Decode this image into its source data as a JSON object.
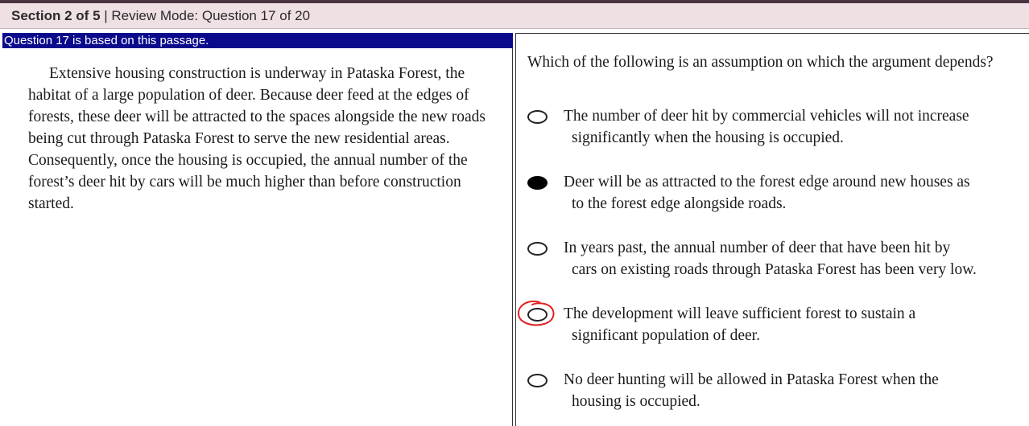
{
  "header": {
    "section": "Section 2 of 5",
    "separator": " | ",
    "mode": "Review Mode: Question 17 of 20"
  },
  "passage": {
    "bar_label": "Question 17 is based on this passage.",
    "text": "Extensive housing construction is underway in Pataska Forest, the habitat of a large population of deer. Because deer feed at the edges of forests, these deer will be attracted to the spaces alongside the new roads being cut through Pataska Forest to serve the new residential areas. Consequently, once the housing is occupied, the annual number of the forest’s deer hit by cars will be much higher than before construction started."
  },
  "question": {
    "stem": "Which of the following is an assumption on which the argument depends?",
    "choices": [
      {
        "line1": "The number of deer hit by commercial vehicles will not increase",
        "line2": "significantly when the housing is occupied.",
        "selected": false
      },
      {
        "line1": "Deer will be as attracted to the forest edge around new houses as",
        "line2": "to the forest edge alongside roads.",
        "selected": true
      },
      {
        "line1": "In years past, the annual number of deer that have been hit by",
        "line2": "cars on existing roads through Pataska Forest has been very low.",
        "selected": false
      },
      {
        "line1": "The development will leave sufficient forest to sustain a",
        "line2": "significant population of deer.",
        "selected": false,
        "annotated": true
      },
      {
        "line1": "No deer hunting will be allowed in Pataska Forest when the",
        "line2": "housing is occupied.",
        "selected": false
      }
    ]
  },
  "colors": {
    "passage_bar": "#0a0a8c",
    "header_bg": "#efe0e4",
    "annotation": "#e02020"
  }
}
